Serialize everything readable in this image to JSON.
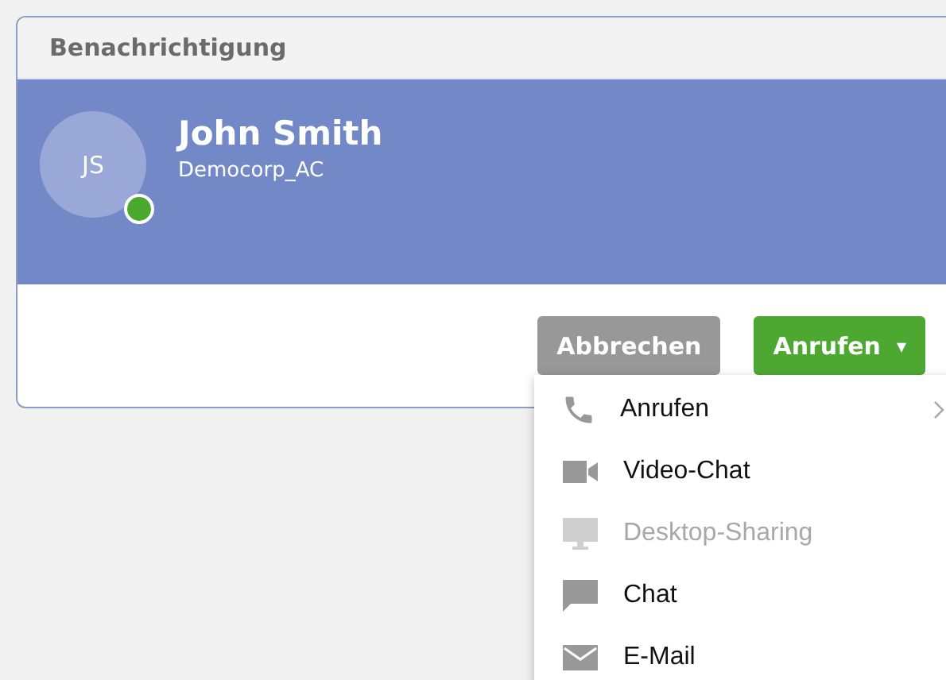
{
  "dialog": {
    "title": "Benachrichtigung"
  },
  "contact": {
    "initials": "JS",
    "name": "John Smith",
    "company": "Democorp_AC",
    "online": true
  },
  "buttons": [
    {
      "label": "Abbrechen",
      "kind": "secondary"
    },
    {
      "label": "Anrufen",
      "kind": "primary",
      "caret": "▾"
    }
  ],
  "menu": {
    "items": [
      {
        "label": "Anrufen",
        "disabled": false,
        "submenu": true
      },
      {
        "label": "Video-Chat",
        "disabled": false,
        "submenu": false
      },
      {
        "label": "Desktop-Sharing",
        "disabled": true,
        "submenu": false
      },
      {
        "label": "Chat",
        "disabled": false,
        "submenu": false
      },
      {
        "label": "E-Mail",
        "disabled": false,
        "submenu": false
      }
    ]
  }
}
